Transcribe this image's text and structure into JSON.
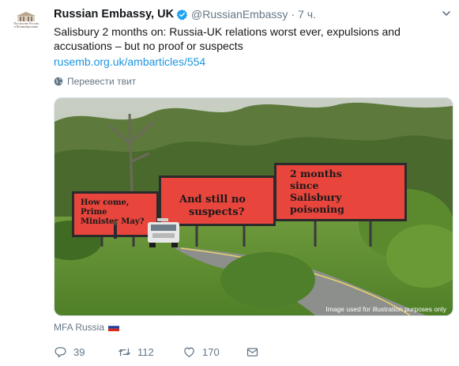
{
  "tweet": {
    "display_name": "Russian Embassy, UK",
    "verified": true,
    "handle": "@RussianEmbassy",
    "separator": "·",
    "time": "7 ч.",
    "text": "Salisbury 2 months on: Russia-UK relations worst ever, expulsions and accusations – but no proof or suspects",
    "link": "rusemb.org.uk/ambarticles/554",
    "translate_label": "Перевести твит",
    "source_label": "MFA Russia"
  },
  "avatar": {
    "line1": "Посольство России",
    "line2": "в Великобритании"
  },
  "media": {
    "billboards": [
      "How come, Prime Minister May?",
      "And still no suspects?",
      "2 months since Salisbury poisoning"
    ],
    "billboard_lines": {
      "b1": [
        "How come,",
        "Prime",
        "Minister May?"
      ],
      "b2": [
        "And still no",
        "suspects?"
      ],
      "b3": [
        "2 months",
        "since",
        "Salisbury",
        "poisoning"
      ]
    },
    "caption": "Image used for illustration purposes only",
    "billboard_color": "#e8453c"
  },
  "actions": {
    "reply": {
      "icon": "reply-icon",
      "count": "39"
    },
    "retweet": {
      "icon": "retweet-icon",
      "count": "112"
    },
    "like": {
      "icon": "heart-icon",
      "count": "170"
    },
    "message": {
      "icon": "envelope-icon"
    }
  },
  "colors": {
    "text": "#14171a",
    "muted": "#657786",
    "link": "#1b95e0",
    "verified": "#1da1f2"
  }
}
